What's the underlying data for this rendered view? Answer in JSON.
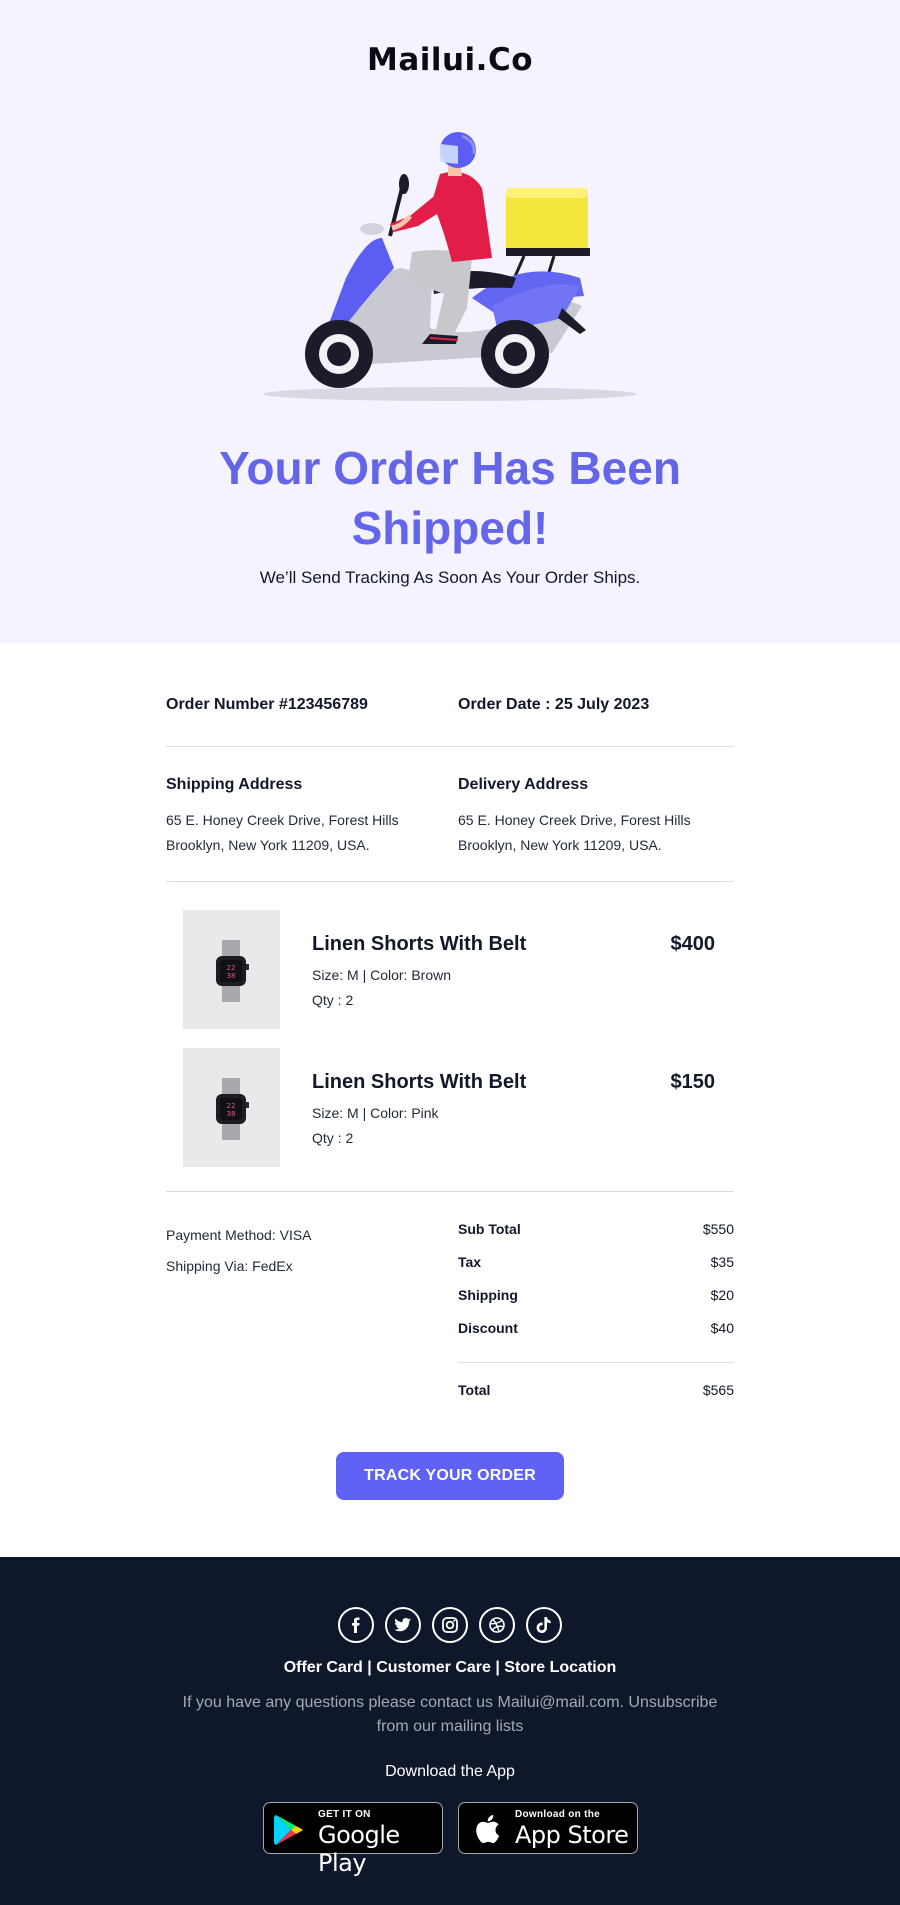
{
  "brand": {
    "logo_text": "Mailui.Co"
  },
  "hero": {
    "title_line1": "Your Order Has Been",
    "title_line2": "Shipped!",
    "subtitle": "We’ll Send Tracking As Soon As Your Order Ships.",
    "illustration": "delivery-scooter-illustration"
  },
  "order": {
    "number_label": "Order Number #123456789",
    "date_label": "Order Date : 25 July 2023"
  },
  "addresses": {
    "shipping": {
      "title": "Shipping Address",
      "line1": "65 E. Honey Creek Drive, Forest Hills",
      "line2": "Brooklyn, New York 11209, USA."
    },
    "delivery": {
      "title": "Delivery Address",
      "line1": "65 E. Honey Creek Drive, Forest Hills",
      "line2": "Brooklyn, New York 11209, USA."
    }
  },
  "items": [
    {
      "name": "Linen Shorts With Belt",
      "price": "$400",
      "variant": "Size: M | Color: Brown",
      "qty": "Qty : 2",
      "image": "smartwatch-product-image"
    },
    {
      "name": "Linen Shorts With Belt",
      "price": "$150",
      "variant": "Size: M | Color: Pink",
      "qty": "Qty : 2",
      "image": "smartwatch-product-image"
    }
  ],
  "payment": {
    "method": "Payment Method: VISA",
    "shipping_via": "Shipping Via: FedEx"
  },
  "totals": {
    "subtotal": {
      "label": "Sub Total",
      "value": "$550"
    },
    "tax": {
      "label": "Tax",
      "value": "$35"
    },
    "shipping": {
      "label": "Shipping",
      "value": "$20"
    },
    "discount": {
      "label": "Discount",
      "value": "$40"
    },
    "total": {
      "label": "Total",
      "value": "$565"
    }
  },
  "cta": {
    "label": "TRACK YOUR ORDER"
  },
  "footer": {
    "social_icons": [
      "facebook-icon",
      "twitter-icon",
      "instagram-icon",
      "dribbble-icon",
      "tiktok-icon"
    ],
    "links": {
      "offer": "Offer Card",
      "care": "Customer Care",
      "store": "Store Location",
      "separator": " | "
    },
    "contact_text": "If you have any questions please contact us Mailui@mail.com. Unsubscribe from our mailing lists",
    "download_label": "Download the App",
    "google_play": {
      "small": "GET IT ON",
      "big": "Google Play"
    },
    "app_store": {
      "small": "Download on the",
      "big": "App Store"
    }
  },
  "colors": {
    "accent": "#6061f5",
    "hero_title": "#6366e8",
    "hero_bg": "#f5f3ff",
    "footer_bg": "#0f172a"
  }
}
